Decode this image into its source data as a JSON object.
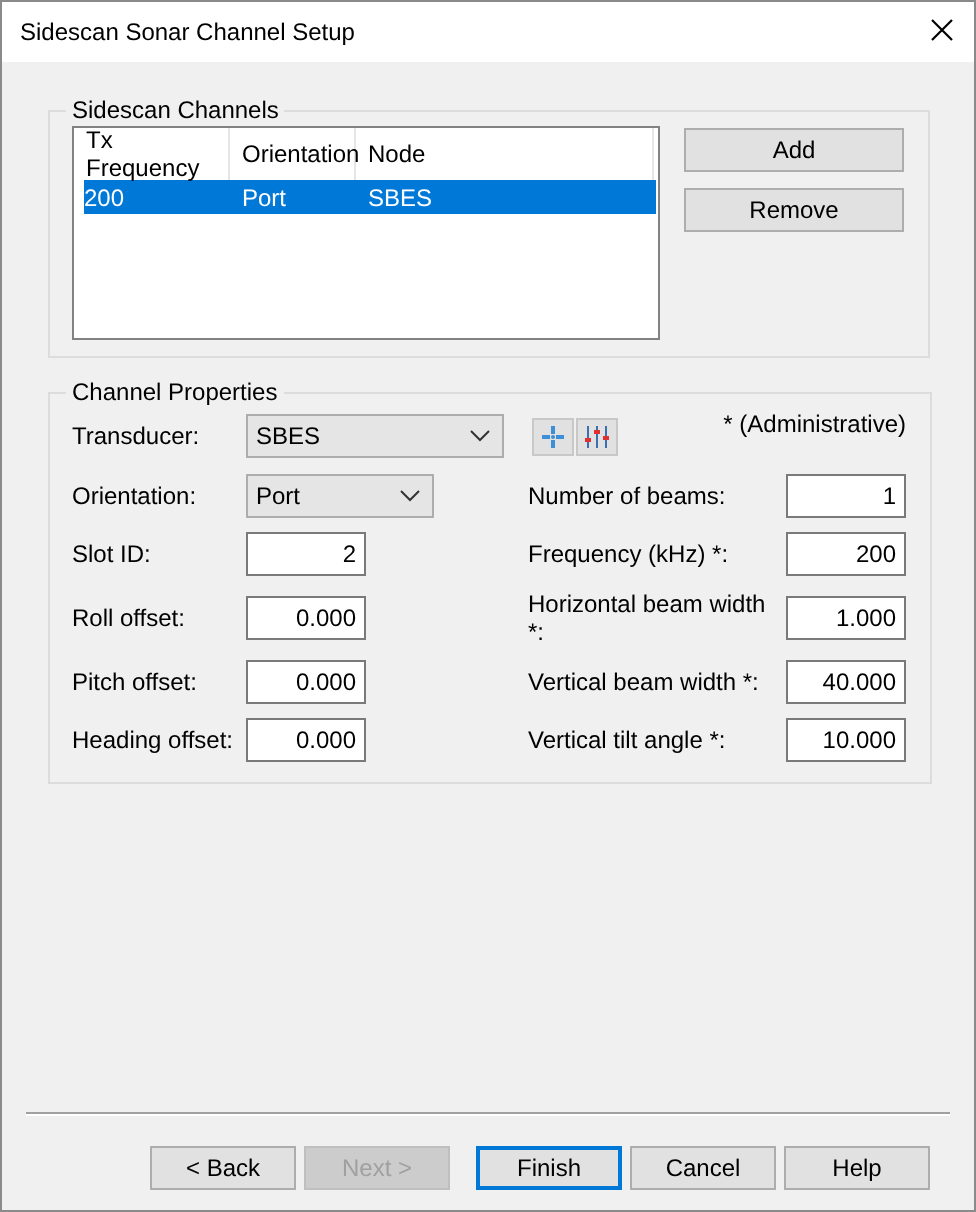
{
  "window": {
    "title": "Sidescan Sonar Channel Setup"
  },
  "channels_group": {
    "title": "Sidescan Channels",
    "columns": [
      "Tx Frequency",
      "Orientation",
      "Node"
    ],
    "rows": [
      {
        "cells": [
          "200",
          "Port",
          "SBES"
        ],
        "selected": true
      }
    ],
    "buttons": [
      "Add",
      "Remove"
    ]
  },
  "properties_group": {
    "title": "Channel Properties",
    "transducer": {
      "label": "Transducer:",
      "value": "SBES"
    },
    "note": "* (Administrative)",
    "orientation": {
      "label": "Orientation:",
      "value": "Port"
    },
    "left_fields": [
      {
        "label": "Slot ID:",
        "value": "2"
      },
      {
        "label": "Roll offset:",
        "value": "0.000"
      },
      {
        "label": "Pitch offset:",
        "value": "0.000"
      },
      {
        "label": "Heading offset:",
        "value": "0.000"
      }
    ],
    "right_fields": [
      {
        "label": "Number of beams:",
        "value": "1"
      },
      {
        "label": "Frequency (kHz) *:",
        "value": "200"
      },
      {
        "label": "Horizontal beam width *:",
        "value": "1.000"
      },
      {
        "label": "Vertical beam width *:",
        "value": "40.000"
      },
      {
        "label": "Vertical tilt angle *:",
        "value": "10.000"
      }
    ]
  },
  "buttons": [
    {
      "label": "< Back",
      "disabled": false,
      "focused": false
    },
    {
      "label": "Next >",
      "disabled": true,
      "focused": false
    },
    {
      "label": "Finish",
      "disabled": false,
      "focused": true
    },
    {
      "label": "Cancel",
      "disabled": false,
      "focused": false
    },
    {
      "label": "Help",
      "disabled": false,
      "focused": false
    }
  ]
}
